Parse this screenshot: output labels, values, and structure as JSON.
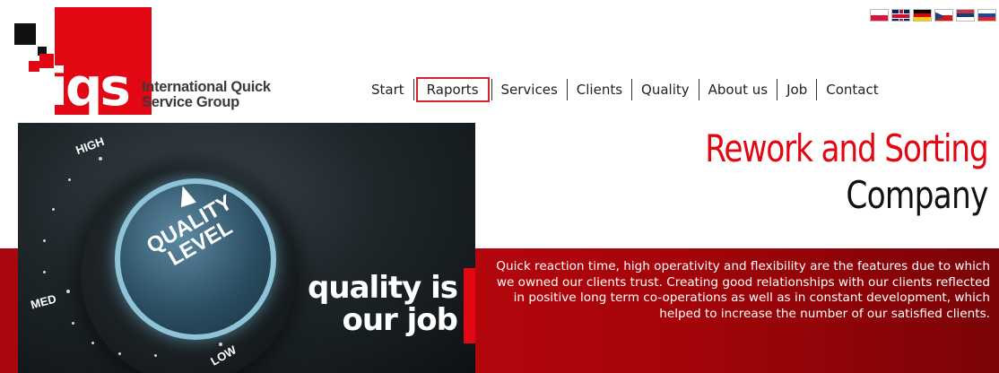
{
  "logo": {
    "letters": "iqs",
    "tagline_line1": "International Quick",
    "tagline_line2": "Service Group"
  },
  "languages": [
    {
      "code": "pl",
      "icon": "poland-flag-icon"
    },
    {
      "code": "en",
      "icon": "uk-flag-icon"
    },
    {
      "code": "de",
      "icon": "germany-flag-icon"
    },
    {
      "code": "cz",
      "icon": "czech-flag-icon"
    },
    {
      "code": "rs",
      "icon": "serbia-flag-icon"
    },
    {
      "code": "sk",
      "icon": "slovakia-flag-icon"
    }
  ],
  "nav": {
    "items": [
      "Start",
      "Raports",
      "Services",
      "Clients",
      "Quality",
      "About us",
      "Job",
      "Contact"
    ],
    "active": "Raports"
  },
  "hero": {
    "dial_high": "HIGH",
    "dial_med": "MED",
    "dial_low": "LOW",
    "knob_line1": "QUALITY",
    "knob_line2": "LEVEL",
    "motto_line1": "quality is",
    "motto_line2": "our job"
  },
  "heading": {
    "line1": "Rework and Sorting",
    "line2": "Company"
  },
  "intro": {
    "text": "Quick reaction time, high operativity and flexibility are the features due to which we owned our clients trust. Creating good relationships with our clients reflected in positive long term co-operations as well as in constant development, which helped to increase the number of our satisfied clients."
  },
  "colors": {
    "brand_red": "#e30613",
    "band_red": "#a30509",
    "text_dark": "#222222"
  }
}
